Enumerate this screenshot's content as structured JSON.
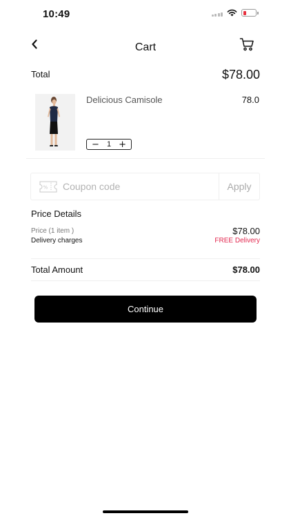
{
  "status_bar": {
    "time": "10:49"
  },
  "nav": {
    "title": "Cart"
  },
  "cart_total": {
    "label": "Total",
    "value": "$78.00"
  },
  "cart_item": {
    "name": "Delicious Camisole",
    "price": "78.0",
    "quantity": "1",
    "decrement_label": "−",
    "increment_label": "+"
  },
  "coupon": {
    "placeholder": "Coupon code",
    "value": "",
    "apply_label": "Apply"
  },
  "price_details": {
    "title": "Price Details",
    "price_label": "Price (1 item )",
    "price_value": "$78.00",
    "delivery_label": "Delivery charges",
    "delivery_value": "FREE Delivery"
  },
  "total_amount": {
    "label": "Total Amount",
    "value": "$78.00"
  },
  "continue_label": "Continue",
  "colors": {
    "free_delivery": "#e2264d",
    "button_bg": "#000000",
    "battery_low": "#e8313f"
  },
  "icons": [
    "back-chevron-icon",
    "cart-icon",
    "coupon-ticket-icon",
    "signal-icon",
    "wifi-icon",
    "battery-icon"
  ]
}
